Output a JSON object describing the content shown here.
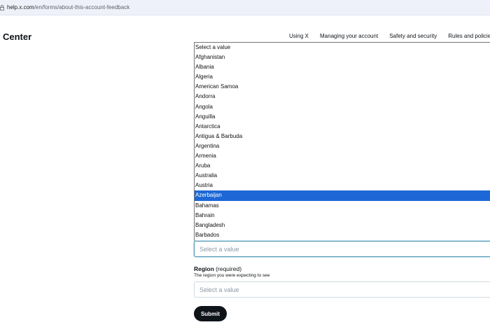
{
  "browser": {
    "url_host": "help.x.com",
    "url_path": "/en/forms/about-this-account-feedback"
  },
  "header": {
    "brand": "Center",
    "nav": [
      "Using X",
      "Managing your account",
      "Safety and security",
      "Rules and policies"
    ]
  },
  "country_dropdown": {
    "options": [
      "Select a value",
      "Afghanistan",
      "Albania",
      "Algeria",
      "American Samoa",
      "Andorra",
      "Angola",
      "Anguilla",
      "Antarctica",
      "Antigua & Barbuda",
      "Argentina",
      "Armenia",
      "Aruba",
      "Australia",
      "Austria",
      "Azerbaijan",
      "Bahamas",
      "Bahrain",
      "Bangladesh",
      "Barbados"
    ],
    "highlighted": "Azerbaijan",
    "value": "Select a value"
  },
  "region": {
    "label": "Region",
    "required": " (required)",
    "help": "The region you were expecting to see",
    "value": "Select a value"
  },
  "submit_label": "Submit",
  "colors": {
    "highlight": "#1d68d6",
    "button": "#0f1419"
  }
}
